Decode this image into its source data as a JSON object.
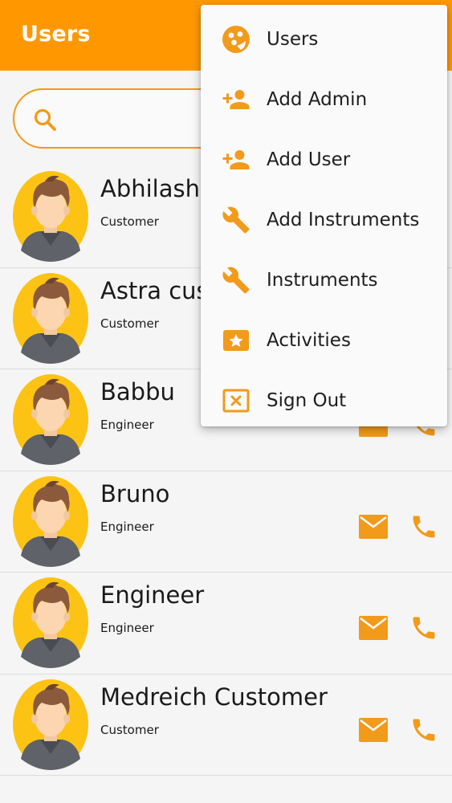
{
  "appbar": {
    "title": "Users"
  },
  "search": {
    "placeholder": "",
    "value": ""
  },
  "colors": {
    "accent": "#ff9800",
    "icon": "#f29a1a"
  },
  "users": [
    {
      "name": "Abhilash",
      "role": "Customer"
    },
    {
      "name": "Astra customer",
      "role": "Customer"
    },
    {
      "name": "Babbu",
      "role": "Engineer"
    },
    {
      "name": "Bruno",
      "role": "Engineer"
    },
    {
      "name": "Engineer",
      "role": "Engineer"
    },
    {
      "name": "Medreich Customer",
      "role": "Customer"
    }
  ],
  "menu": {
    "items": [
      {
        "label": "Users",
        "icon": "users-icon"
      },
      {
        "label": "Add Admin",
        "icon": "person-add-icon"
      },
      {
        "label": "Add User",
        "icon": "person-add-icon"
      },
      {
        "label": "Add Instruments",
        "icon": "wrench-icon"
      },
      {
        "label": "Instruments",
        "icon": "wrench-icon"
      },
      {
        "label": "Activities",
        "icon": "activities-icon"
      },
      {
        "label": "Sign Out",
        "icon": "sign-out-icon"
      }
    ]
  }
}
